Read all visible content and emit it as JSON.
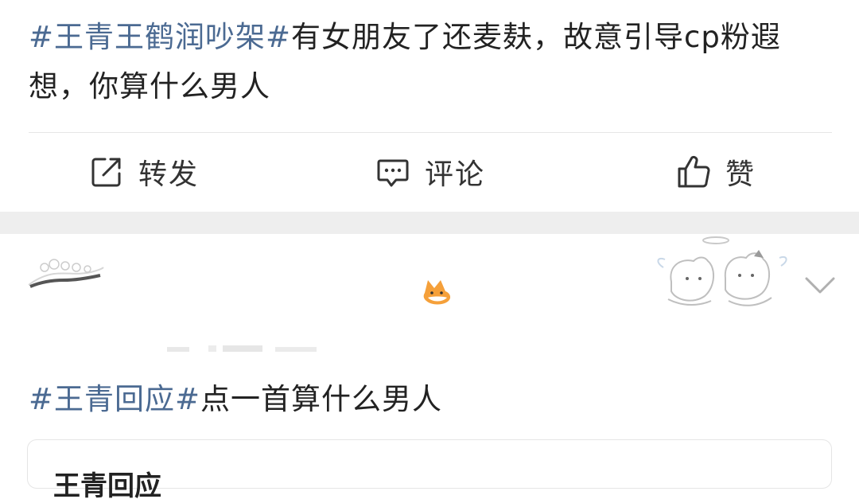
{
  "post1": {
    "hashtag": "#王青王鹤润吵架#",
    "text": "有女朋友了还麦麸，故意引导cp粉遐想，你算什么男人"
  },
  "actions": {
    "repost_label": "转发",
    "comment_label": "评论",
    "like_label": "赞"
  },
  "post2": {
    "hashtag": "#王青回应#",
    "text": "点一首算什么男人",
    "quote_title": "王青回应"
  },
  "colors": {
    "hashtag": "#4b6a92",
    "separator_band": "#eeeeee",
    "text": "#222222"
  },
  "icons": {
    "repost": "share-out-icon",
    "comment": "comment-bubble-icon",
    "like": "thumbs-up-icon",
    "chevron": "chevron-down-icon",
    "fox": "fox-emoji-icon"
  }
}
